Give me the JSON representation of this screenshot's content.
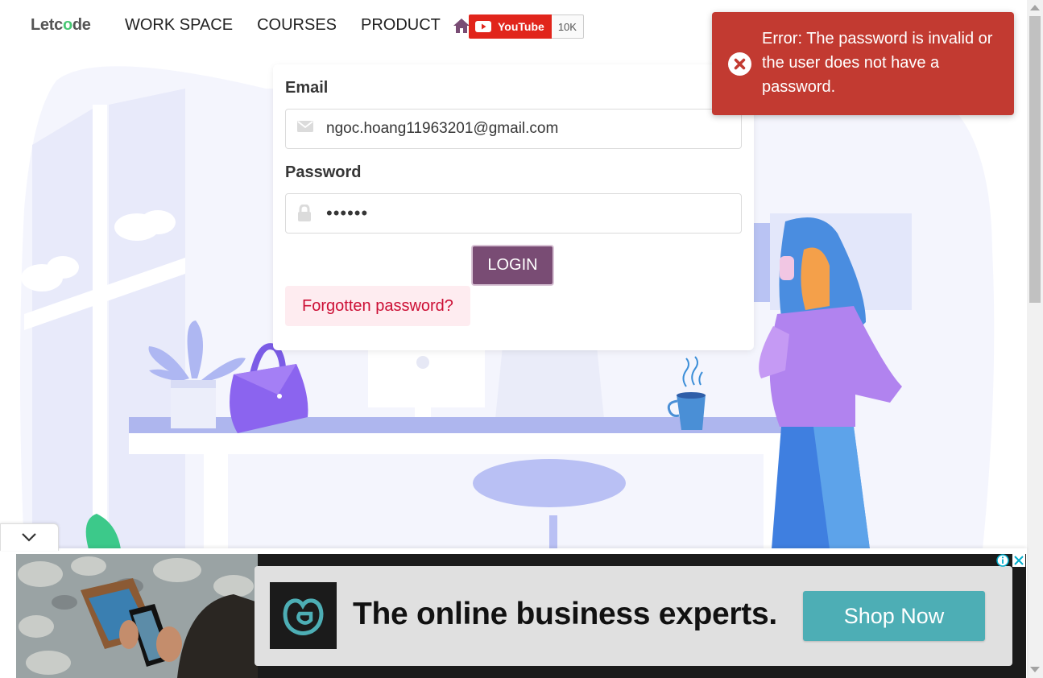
{
  "header": {
    "logo_text_a": "Letc",
    "logo_text_o": "o",
    "logo_text_b": "de",
    "nav": [
      {
        "label": "WORK SPACE"
      },
      {
        "label": "COURSES"
      },
      {
        "label": "PRODUCT"
      }
    ],
    "youtube": {
      "label": "YouTube",
      "count": "10K"
    }
  },
  "login": {
    "email_label": "Email",
    "email_value": "ngoc.hoang11963201@gmail.com",
    "password_label": "Password",
    "password_value": "••••••",
    "login_button": "LOGIN",
    "forgot_link": "Forgotten password?"
  },
  "toast": {
    "message": "Error: The password is invalid or the user does not have a password.",
    "icon": "error-circle-x-icon"
  },
  "ad": {
    "headline": "The online business experts.",
    "cta": "Shop Now",
    "brand_icon": "godaddy-g-icon"
  },
  "colors": {
    "accent": "#794c74",
    "error_toast": "#c23a31",
    "ad_cta": "#4daeb5",
    "forgot_bg": "#feecf0",
    "forgot_text": "#cc0f35"
  }
}
